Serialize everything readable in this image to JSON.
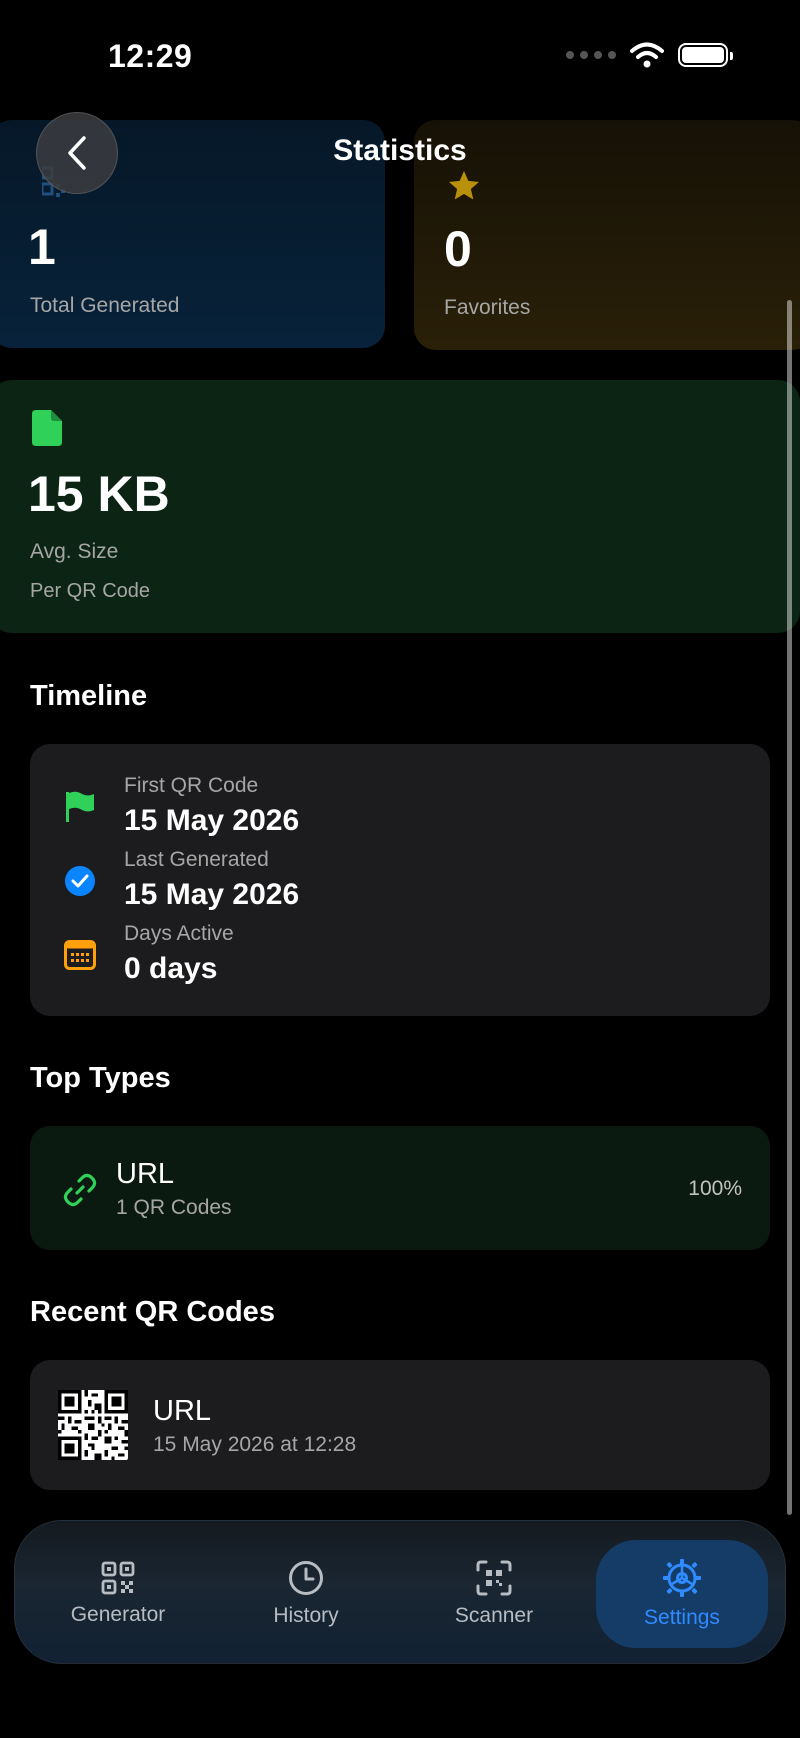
{
  "status_bar": {
    "time": "12:29"
  },
  "header": {
    "title": "Statistics"
  },
  "stats": {
    "total": {
      "value": "1",
      "label": "Total Generated"
    },
    "favorites": {
      "value": "0",
      "label": "Favorites"
    },
    "avg_size": {
      "value": "15 KB",
      "label": "Avg. Size",
      "sublabel": "Per QR Code"
    }
  },
  "timeline": {
    "title": "Timeline",
    "items": [
      {
        "label": "First QR Code",
        "value": "15 May 2026",
        "icon": "flag-icon"
      },
      {
        "label": "Last Generated",
        "value": "15 May 2026",
        "icon": "checkmark-circle-icon"
      },
      {
        "label": "Days Active",
        "value": "0 days",
        "icon": "calendar-icon"
      }
    ]
  },
  "top_types": {
    "title": "Top Types",
    "items": [
      {
        "name": "URL",
        "count": "1 QR Codes",
        "percent": "100%",
        "icon": "link-icon"
      }
    ]
  },
  "recent": {
    "title": "Recent QR Codes",
    "items": [
      {
        "name": "URL",
        "date": "15 May 2026 at 12:28"
      }
    ]
  },
  "tabs": [
    {
      "label": "Generator",
      "icon": "qr-grid-icon",
      "active": false
    },
    {
      "label": "History",
      "icon": "clock-icon",
      "active": false
    },
    {
      "label": "Scanner",
      "icon": "qr-scan-icon",
      "active": false
    },
    {
      "label": "Settings",
      "icon": "gear-icon",
      "active": true
    }
  ],
  "colors": {
    "accent_blue": "#2f8bff",
    "green": "#30d158",
    "orange": "#ff9f0a",
    "gold": "#d9a60a"
  }
}
